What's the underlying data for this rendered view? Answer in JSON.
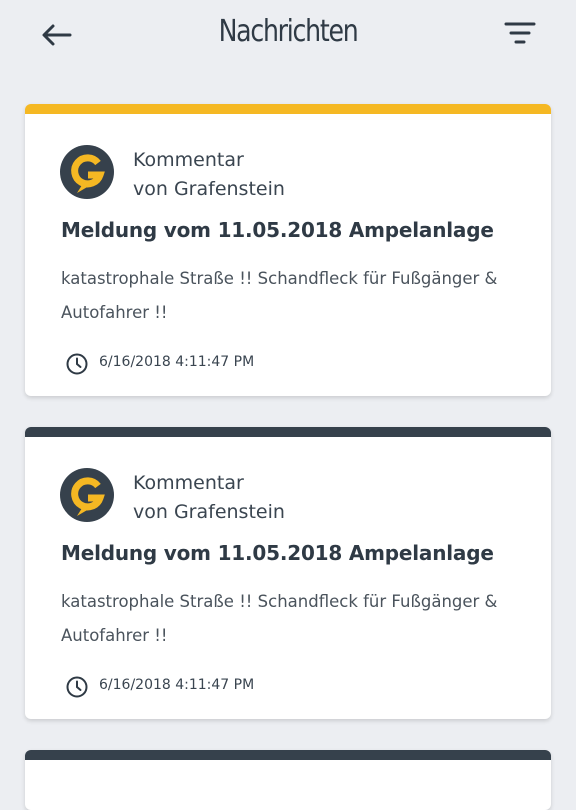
{
  "header": {
    "title": "Nachrichten",
    "back_icon": "arrow-left-icon",
    "filter_icon": "filter-icon"
  },
  "colors": {
    "accent": "#f5b823",
    "dark": "#36414c",
    "background": "#eceef2"
  },
  "messages": [
    {
      "author_line1": "Kommentar",
      "author_line2": "von Grafenstein",
      "title": "Meldung vom 11.05.2018 Ampelanlage",
      "body": "katastrophale Straße !! Schandfleck für Fußgänger & Autofahrer !!",
      "timestamp": "6/16/2018 4:11:47 PM",
      "logo_icon": "grafenstein-logo-icon",
      "clock_icon": "clock-icon"
    },
    {
      "author_line1": "Kommentar",
      "author_line2": "von Grafenstein",
      "title": "Meldung vom 11.05.2018 Ampelanlage",
      "body": "katastrophale Straße !! Schandfleck für Fußgänger & Autofahrer !!",
      "timestamp": "6/16/2018 4:11:47 PM",
      "logo_icon": "grafenstein-logo-icon",
      "clock_icon": "clock-icon"
    }
  ]
}
